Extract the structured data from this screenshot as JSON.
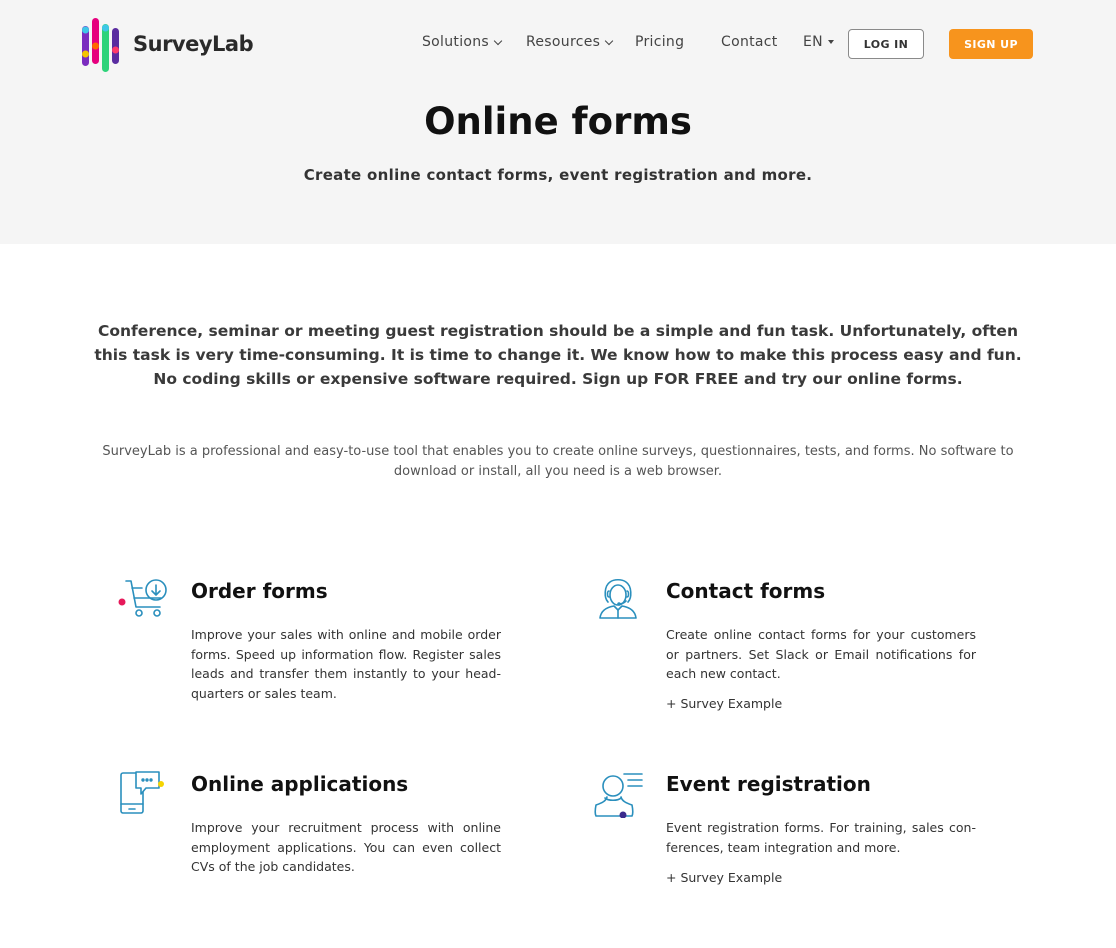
{
  "brand": {
    "name": "SurveyLab"
  },
  "nav": {
    "solutions": "Solutions",
    "resources": "Resources",
    "pricing": "Pricing",
    "contact": "Contact",
    "language": "EN",
    "login": "LOG IN",
    "signup": "SIGN UP"
  },
  "hero": {
    "title": "Online forms",
    "subtitle": "Create online contact forms, event registration and more."
  },
  "lead": "Conference, seminar or meeting guest registration should be a simple and fun task. Unfortunately, often this task is very time-consuming. It is time to change it. We know how to make this process easy and fun. No coding skills or expensive software required. Sign up FOR FREE and try our online forms.",
  "intro": "SurveyLab is a professional and easy-to-use tool that enables you to create online surveys, questionnaires, tests, and forms. No software to download or install, all you need is a web browser.",
  "features": [
    {
      "icon": "shopping-cart-icon",
      "title": "Order forms",
      "text": "Improve your sales with online and mobile order forms. Speed up information flow. Register sales leads and transfer them instantly to your head-quarters or sales team."
    },
    {
      "icon": "support-agent-icon",
      "title": "Contact forms",
      "text": "Create online contact forms for your customers or partners. Set Slack or Email notifications for each new contact.",
      "link": "+ Survey Example"
    },
    {
      "icon": "mobile-chat-icon",
      "title": "Online applications",
      "text": "Improve your recruitment process with online employment applications. You can even collect CVs of the job candidates."
    },
    {
      "icon": "person-list-icon",
      "title": "Event registration",
      "text": "Event registration forms. For training, sales con-ferences, team integration and more.",
      "link": "+ Survey Example"
    }
  ],
  "colors": {
    "accent": "#f7941d",
    "icon_stroke": "#2a8fbd",
    "hero_bg": "#f5f5f5"
  }
}
